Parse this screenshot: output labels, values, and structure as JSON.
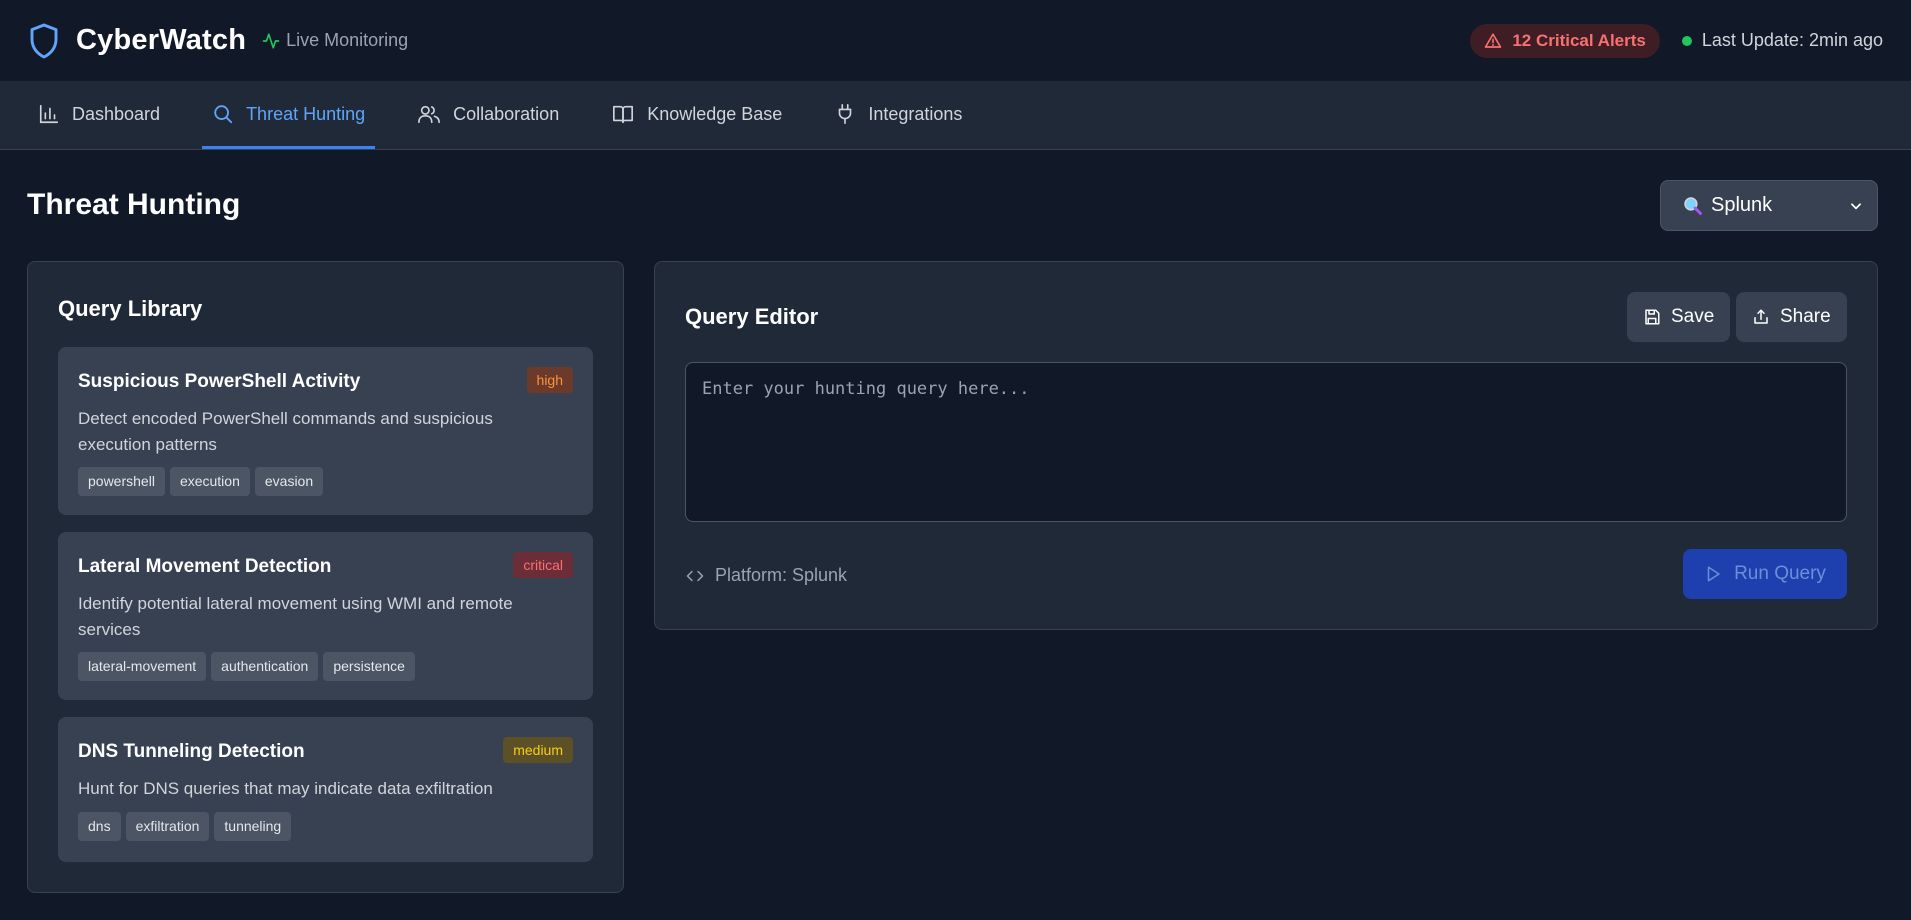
{
  "header": {
    "app_title": "CyberWatch",
    "live_label": "Live Monitoring",
    "alerts_label": "12 Critical Alerts",
    "last_update": "Last Update: 2min ago"
  },
  "nav": {
    "tabs": [
      {
        "label": "Dashboard",
        "icon": "bar-chart-icon"
      },
      {
        "label": "Threat Hunting",
        "icon": "search-icon",
        "active": true
      },
      {
        "label": "Collaboration",
        "icon": "users-icon"
      },
      {
        "label": "Knowledge Base",
        "icon": "book-icon"
      },
      {
        "label": "Integrations",
        "icon": "plug-icon"
      }
    ]
  },
  "page": {
    "title": "Threat Hunting",
    "platform_select": {
      "selected": "Splunk",
      "icon": "magnifier-emoji-icon"
    }
  },
  "library": {
    "title": "Query Library",
    "queries": [
      {
        "title": "Suspicious PowerShell Activity",
        "severity": "high",
        "description": "Detect encoded PowerShell commands and suspicious execution patterns",
        "tags": [
          "powershell",
          "execution",
          "evasion"
        ]
      },
      {
        "title": "Lateral Movement Detection",
        "severity": "critical",
        "description": "Identify potential lateral movement using WMI and remote services",
        "tags": [
          "lateral-movement",
          "authentication",
          "persistence"
        ]
      },
      {
        "title": "DNS Tunneling Detection",
        "severity": "medium",
        "description": "Hunt for DNS queries that may indicate data exfiltration",
        "tags": [
          "dns",
          "exfiltration",
          "tunneling"
        ]
      }
    ]
  },
  "editor": {
    "title": "Query Editor",
    "save_label": "Save",
    "share_label": "Share",
    "query_value": "",
    "query_placeholder": "Enter your hunting query here...",
    "platform_label": "Platform: Splunk",
    "run_label": "Run Query"
  },
  "colors": {
    "background": "#111827",
    "panel": "#1f2937",
    "card": "#374151",
    "accent": "#3b82f6",
    "alert": "#f87171",
    "live": "#22c55e"
  }
}
